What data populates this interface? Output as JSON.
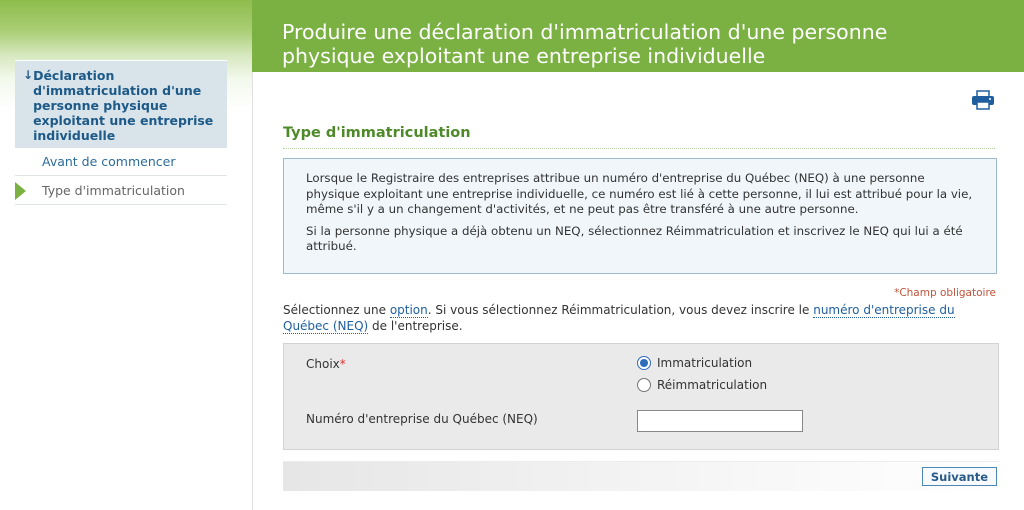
{
  "header": {
    "title": "Produire une déclaration d'immatriculation d'une personne physique exploitant une entreprise individuelle"
  },
  "sidebar": {
    "current_section": "Déclaration d'immatriculation d'une personne physique exploitant une entreprise individuelle",
    "items": [
      {
        "label": "Avant de commencer",
        "state": "link"
      },
      {
        "label": "Type d'immatriculation",
        "state": "current"
      }
    ]
  },
  "main": {
    "print_icon": "printer-icon",
    "section_title": "Type d'immatriculation",
    "info": {
      "paragraph1": "Lorsque le Registraire des entreprises attribue un numéro d'entreprise du Québec (NEQ) à une personne physique exploitant une entreprise individuelle, ce numéro est lié à cette personne, il lui est attribué pour la vie, même s'il y a un changement d'activités, et ne peut pas être transféré à une autre personne.",
      "paragraph2": "Si la personne physique a déjà obtenu un NEQ, sélectionnez Réimmatriculation et inscrivez le NEQ qui lui a été attribué."
    },
    "required_note": "*Champ obligatoire",
    "instruction": {
      "part1": "Sélectionnez une ",
      "link_option": "option",
      "part2": ". Si vous sélectionnez Réimmatriculation, vous devez inscrire le ",
      "link_neq": "numéro d'entreprise du Québec (NEQ)",
      "part3": " de l'entreprise."
    },
    "form": {
      "choice_label": "Choix",
      "required_mark": "*",
      "options": [
        {
          "label": "Immatriculation",
          "checked": true
        },
        {
          "label": "Réimmatriculation",
          "checked": false
        }
      ],
      "neq_label": "Numéro d'entreprise du Québec (NEQ)",
      "neq_value": ""
    },
    "next_button": "Suivante"
  },
  "colors": {
    "brand_green": "#7ab142",
    "section_green": "#4f8a2a",
    "link_blue": "#2060a0",
    "required_red": "#c0533b"
  }
}
